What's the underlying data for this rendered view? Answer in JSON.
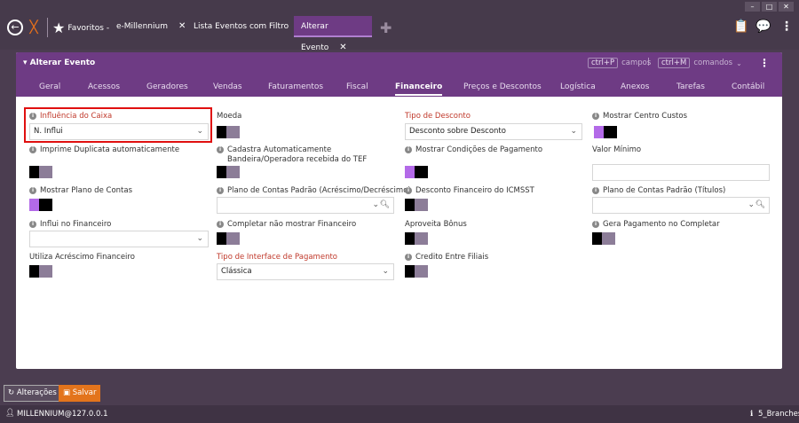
{
  "window": {
    "min": "–",
    "max": "□",
    "close": "✕"
  },
  "nav": {
    "favorites": "Favoritos -"
  },
  "tabs": [
    {
      "label": "e-Millennium"
    },
    {
      "label": "Lista Eventos com Filtro"
    },
    {
      "label": "Alterar Evento"
    }
  ],
  "panel": {
    "title": "Alterar Evento",
    "kbd1": "ctrl+P",
    "kbd1_text": "campos",
    "sep": "|",
    "kbd2": "ctrl+M",
    "kbd2_text": "comandos",
    "tabs": [
      "Geral",
      "Acessos",
      "Geradores",
      "Vendas",
      "Faturamentos",
      "Fiscal",
      "Financeiro",
      "Preços e Descontos",
      "Logística",
      "Anexos",
      "Tarefas",
      "Contábil"
    ],
    "active_tab": "Financeiro"
  },
  "fields": {
    "influencia_caixa": {
      "label": "Influência do Caixa",
      "value": "N. Influi"
    },
    "moeda": {
      "label": "Moeda"
    },
    "tipo_desconto": {
      "label": "Tipo de Desconto",
      "value": "Desconto sobre Desconto"
    },
    "mostrar_centro_custos": {
      "label": "Mostrar Centro Custos"
    },
    "imprime_duplicata": {
      "label": "Imprime Duplicata automaticamente"
    },
    "cadastra_bandeira": {
      "label": "Cadastra Automaticamente Bandeira/Operadora recebida do TEF"
    },
    "mostrar_condicoes": {
      "label": "Mostrar Condições de Pagamento"
    },
    "valor_minimo": {
      "label": "Valor Mínimo"
    },
    "mostrar_plano": {
      "label": "Mostrar Plano de Contas"
    },
    "plano_acrescimo": {
      "label": "Plano de Contas Padrão (Acréscimo/Decréscimo)"
    },
    "desconto_icmsst": {
      "label": "Desconto Financeiro do ICMSST"
    },
    "plano_titulos": {
      "label": "Plano de Contas Padrão (Títulos)"
    },
    "influi_financeiro": {
      "label": "Influi no Financeiro"
    },
    "completar_nao": {
      "label": "Completar não mostrar Financeiro"
    },
    "aproveita_bonus": {
      "label": "Aproveita Bônus"
    },
    "gera_pagamento": {
      "label": "Gera Pagamento no Completar"
    },
    "utiliza_acrescimo": {
      "label": "Utiliza Acréscimo Financeiro"
    },
    "tipo_interface": {
      "label": "Tipo de Interface de Pagamento",
      "value": "Clássica"
    },
    "credito_filiais": {
      "label": "Credito Entre Filiais"
    }
  },
  "actions": {
    "alteracoes": "Alterações",
    "salvar": "Salvar"
  },
  "status": {
    "user": "MILLENNIUM@127.0.0.1",
    "branch": "5_Branches"
  }
}
